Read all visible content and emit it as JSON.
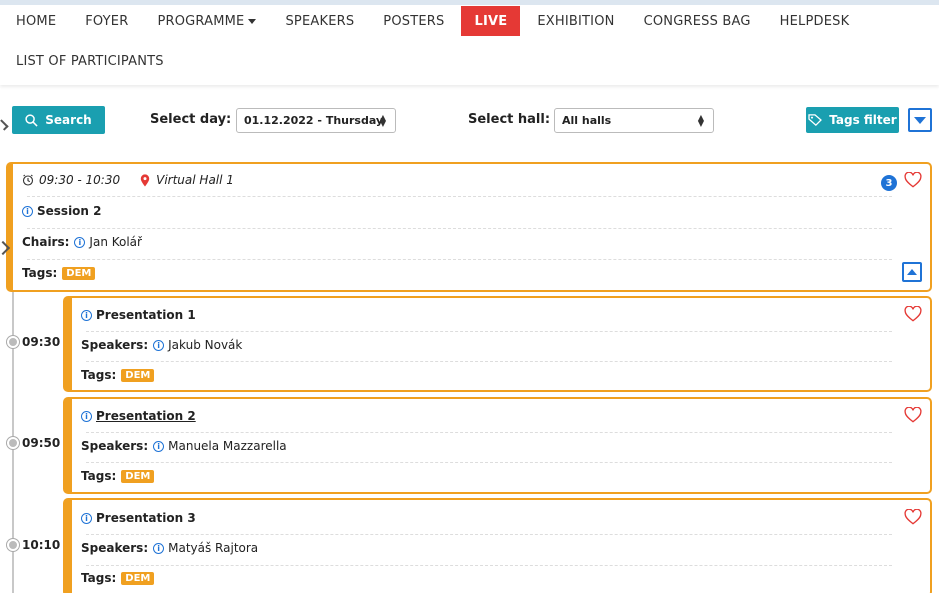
{
  "nav": {
    "items": [
      "HOME",
      "FOYER",
      "PROGRAMME",
      "SPEAKERS",
      "POSTERS",
      "LIVE",
      "EXHIBITION",
      "CONGRESS BAG",
      "HELPDESK"
    ],
    "row2": "LIST OF PARTICIPANTS",
    "active": "LIVE"
  },
  "toolbar": {
    "search_label": "Search",
    "day_label": "Select day:",
    "day_value": "01.12.2022 - Thursday",
    "hall_label": "Select hall:",
    "hall_value": "All halls",
    "tags_filter_label": "Tags filter"
  },
  "session": {
    "time": "09:30 - 10:30",
    "hall": "Virtual Hall 1",
    "badge": "3",
    "title": "Session 2",
    "chairs_label": "Chairs:",
    "chairs": "Jan Kolář",
    "tags_label": "Tags:",
    "tag": "DEM"
  },
  "presentations": [
    {
      "time": "09:30",
      "title": "Presentation 1",
      "speakers_label": "Speakers:",
      "speaker": "Jakub Novák",
      "tags_label": "Tags:",
      "tag": "DEM"
    },
    {
      "time": "09:50",
      "title": "Presentation 2",
      "speakers_label": "Speakers:",
      "speaker": "Manuela Mazzarella",
      "tags_label": "Tags:",
      "tag": "DEM"
    },
    {
      "time": "10:10",
      "title": "Presentation 3",
      "speakers_label": "Speakers:",
      "speaker": "Matyáš Rajtora",
      "tags_label": "Tags:",
      "tag": "DEM"
    }
  ],
  "colors": {
    "accent": "#f0a020",
    "live": "#e53935",
    "teal": "#1a9fb0",
    "blue": "#1f73d6"
  },
  "icons": [
    "search-icon",
    "tag-icon",
    "clock-icon",
    "location-pin-icon",
    "info-icon",
    "heart-icon",
    "chevron-down-icon",
    "chevron-up-icon"
  ]
}
